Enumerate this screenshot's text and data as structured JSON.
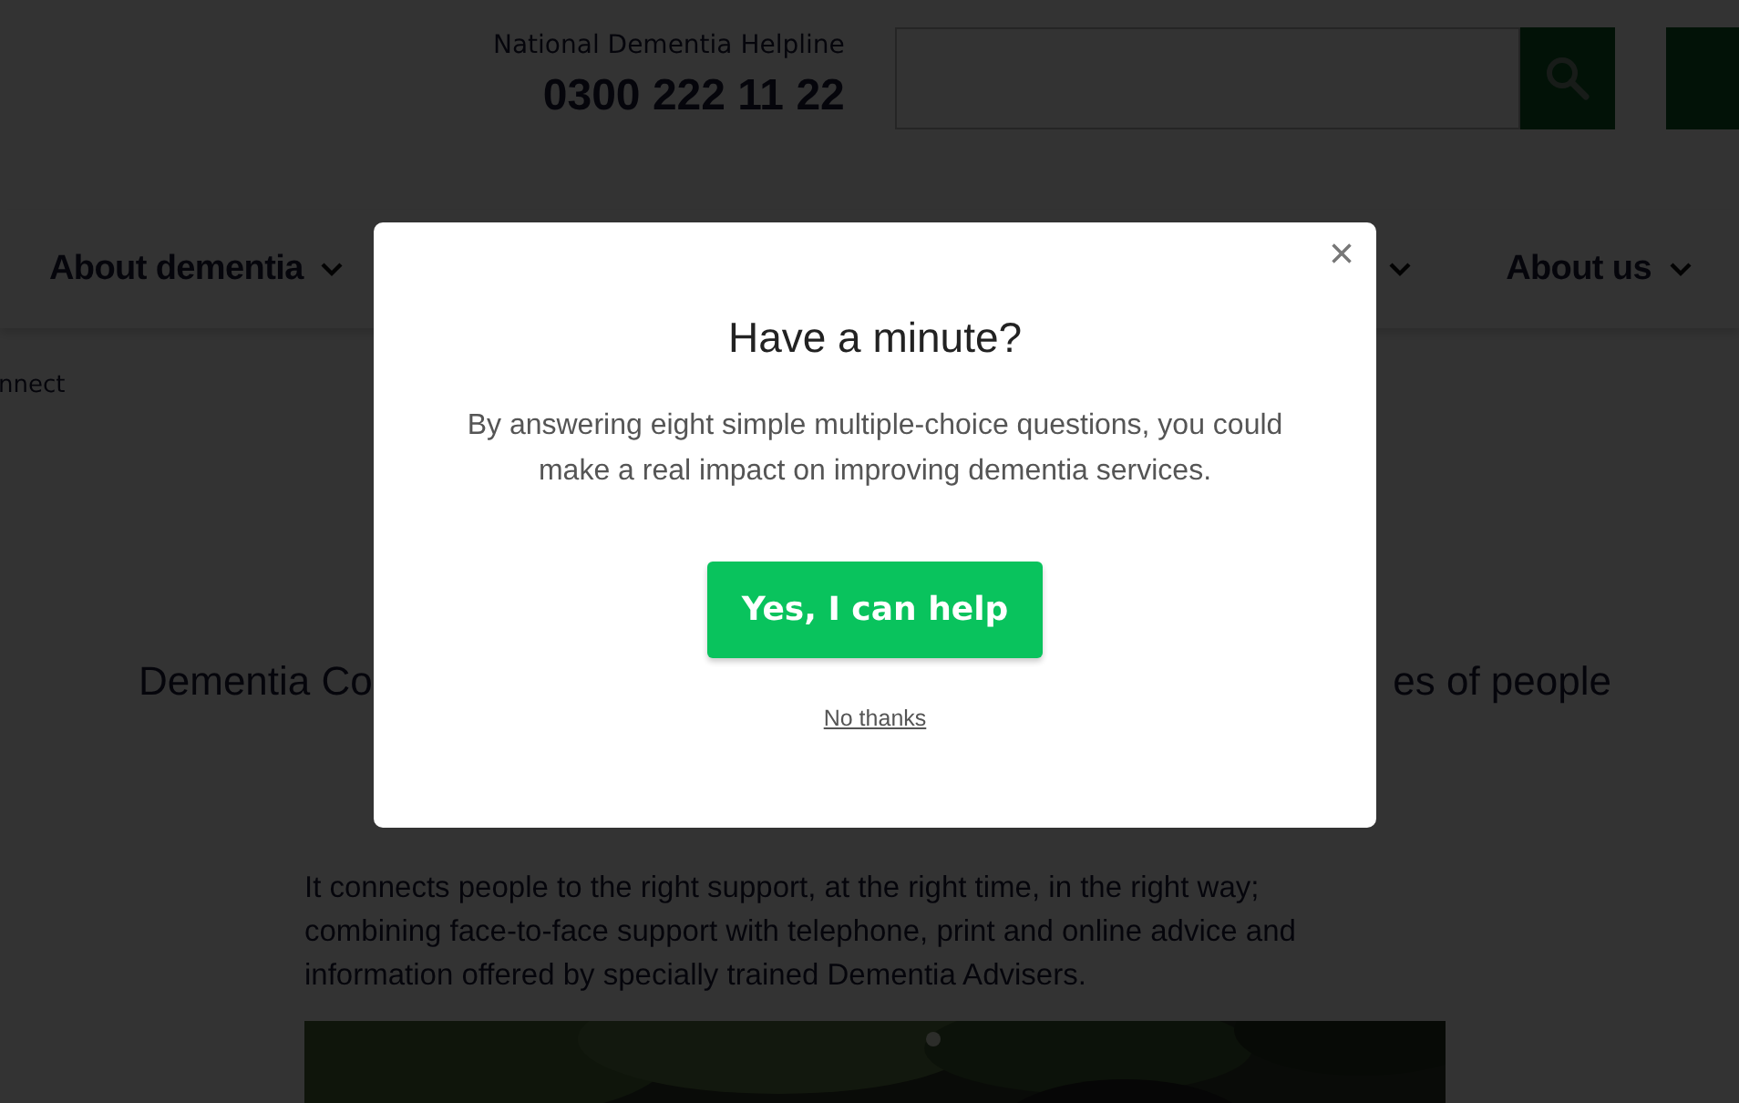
{
  "header": {
    "helpline_label": "National Dementia Helpline",
    "helpline_number": "0300 222 11 22"
  },
  "nav": {
    "items": [
      {
        "label": "About dementia",
        "kind": "left"
      },
      {
        "label": "About us",
        "kind": "right"
      }
    ]
  },
  "breadcrumb": "nnect",
  "heading_parts": [
    "Dementia Co",
    "es of people"
  ],
  "paragraph": "It connects people to the right support, at the right time, in the right way; combining face-to-face support with telephone, print and online advice and information offered by specially trained Dementia Advisers.",
  "modal": {
    "close": "×",
    "title": "Have a minute?",
    "body": "By answering eight simple multiple-choice questions, you could make a real impact on improving dementia services.",
    "primary_button": "Yes, I can help",
    "secondary_link": "No thanks"
  }
}
